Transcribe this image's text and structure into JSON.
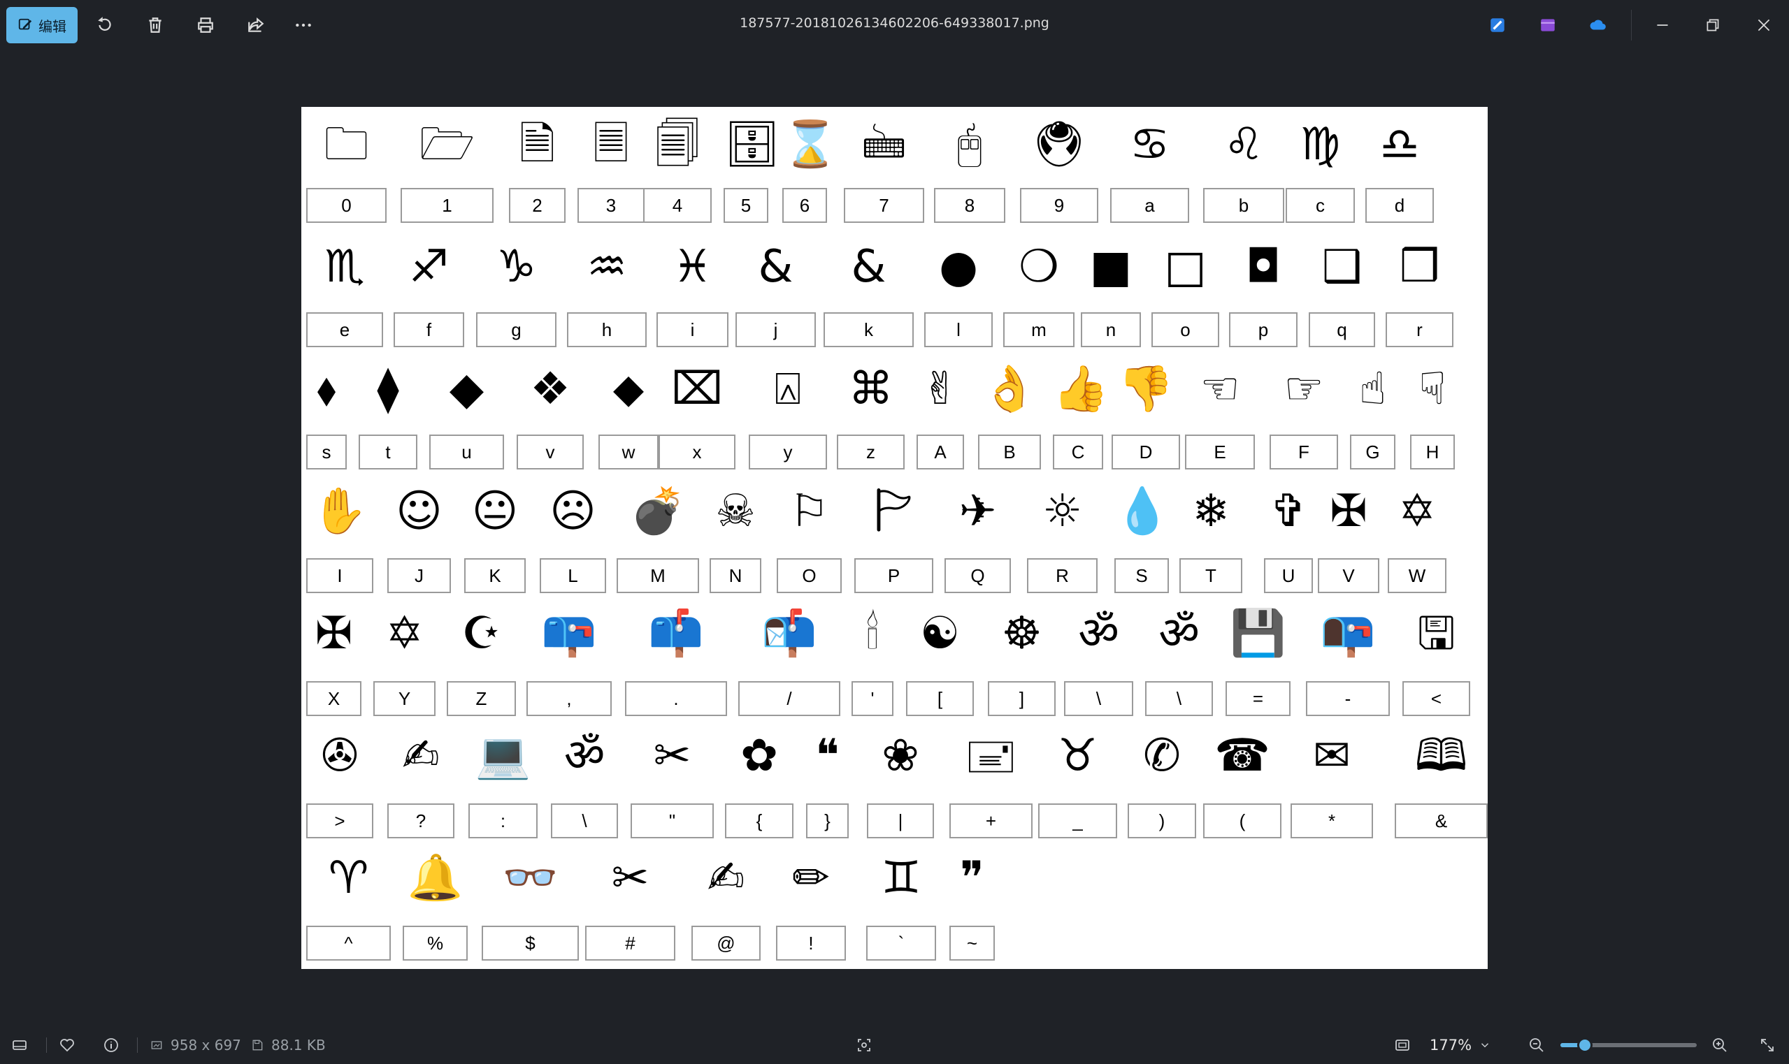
{
  "app": {
    "title": "187577-20181026134602206-649338017.png",
    "edit_label": "编辑",
    "colors": {
      "accent": "#5fb6e8",
      "background": "#1f2227"
    }
  },
  "toolbar_icons": [
    "rotate-icon",
    "delete-icon",
    "print-icon",
    "share-icon",
    "more-icon"
  ],
  "title_bar_icons": [
    "designer-icon",
    "clipchamp-icon",
    "onedrive-icon",
    "minimize-icon",
    "restore-icon",
    "close-icon"
  ],
  "status": {
    "dimensions": "958 x 697",
    "filesize": "88.1 KB",
    "zoom": "177%",
    "zoom_level": 0.18
  },
  "glyph_rows": [
    {
      "glyphs": [
        "🗀",
        "🗁",
        "🗎",
        "🗏",
        "🗐",
        "🗄",
        "⌛",
        "🖮",
        "🖰",
        "🖲",
        "♋",
        "♌",
        "♍",
        "♎"
      ],
      "keys": [
        "0",
        "1",
        "2",
        "3",
        "4",
        "5",
        "6",
        "7",
        "8",
        "9",
        "a",
        "b",
        "c",
        "d"
      ]
    },
    {
      "glyphs": [
        "♏",
        "♐",
        "♑",
        "♒",
        "♓",
        "&",
        "&",
        "●",
        "❍",
        "■",
        "□",
        "◘",
        "❑",
        "❒"
      ],
      "keys": [
        "e",
        "f",
        "g",
        "h",
        "i",
        "j",
        "k",
        "l",
        "m",
        "n",
        "o",
        "p",
        "q",
        "r"
      ]
    },
    {
      "glyphs": [
        "⬧",
        "⧫",
        "◆",
        "❖",
        "⬥",
        "⌧",
        "⍓",
        "⌘",
        "✌",
        "👌",
        "👍",
        "👎",
        "☜",
        "☞",
        "☝",
        "☟"
      ],
      "keys": [
        "s",
        "t",
        "u",
        "v",
        "w",
        "x",
        "y",
        "z",
        "A",
        "B",
        "C",
        "D",
        "E",
        "F",
        "G",
        "H"
      ]
    },
    {
      "glyphs": [
        "✋",
        "☺",
        "😐",
        "☹",
        "💣",
        "☠",
        "⚐",
        "🏱",
        "✈",
        "☼",
        "💧",
        "❄",
        "✞",
        "✠",
        "✡"
      ],
      "keys": [
        "I",
        "J",
        "K",
        "L",
        "M",
        "N",
        "O",
        "P",
        "Q",
        "R",
        "S",
        "T",
        "U",
        "V",
        "W"
      ]
    },
    {
      "glyphs": [
        "✠",
        "✡",
        "☪",
        "📪",
        "📫",
        "📬",
        "🕯",
        "☯",
        "☸",
        "ॐ",
        "ॐ",
        "💾",
        "📭",
        "🖫"
      ],
      "keys": [
        "X",
        "Y",
        "Z",
        ",",
        ".",
        "/",
        "'",
        "[",
        "]",
        "\\",
        "\\",
        "=",
        "-",
        "<"
      ]
    },
    {
      "glyphs": [
        "✇",
        "✍",
        "💻",
        "ॐ",
        "✂",
        "✿",
        "❝",
        "❀",
        "🖃",
        "♉",
        "✆",
        "☎",
        "✉",
        "🕮"
      ],
      "keys": [
        ">",
        "?",
        ":",
        "\\",
        "\"",
        "{",
        "}",
        "|",
        "+",
        "_",
        ")",
        "(",
        "*",
        "&"
      ]
    },
    {
      "glyphs": [
        "♈",
        "🔔",
        "👓",
        "✂",
        "✍",
        "✏",
        "♊",
        "❞"
      ],
      "keys": [
        "^",
        "%",
        "$",
        "#",
        "@",
        "!",
        "`",
        "~"
      ]
    }
  ]
}
